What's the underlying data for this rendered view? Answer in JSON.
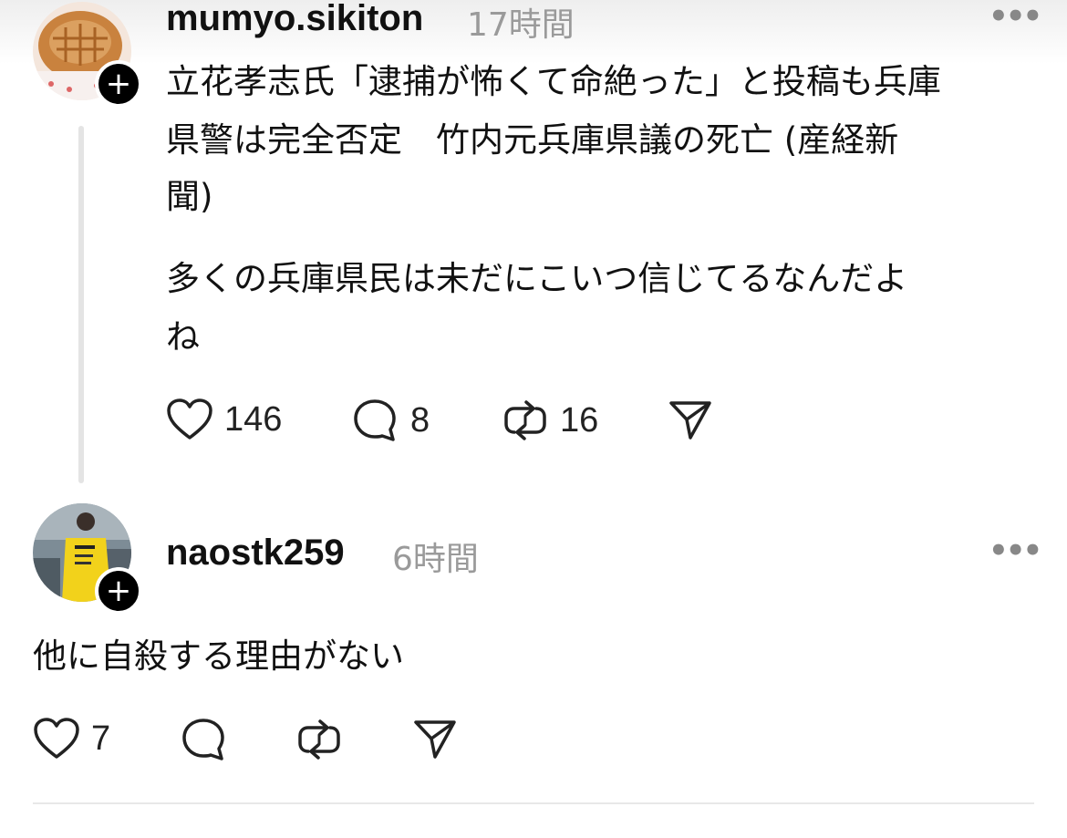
{
  "post1": {
    "username": "mumyo.sikiton",
    "time": "17時間",
    "more": "•••",
    "follow_symbol": "+",
    "line1": "立花孝志氏「逮捕が怖くて命絶った」と投稿も兵庫",
    "line2": "県警は完全否定　竹内元兵庫県議の死亡 (産経新",
    "line3": "聞)",
    "line4": "多くの兵庫県民は未だにこいつ信じてるなんだよ",
    "line5": "ね",
    "likes": "146",
    "replies": "8",
    "reposts": "16"
  },
  "post2": {
    "username": "naostk259",
    "time": "6時間",
    "more": "•••",
    "follow_symbol": "+",
    "text": "他に自殺する理由がない",
    "likes": "7",
    "replies": "",
    "reposts": ""
  },
  "icons": {
    "like": "heart-icon",
    "reply": "comment-icon",
    "repost": "repost-icon",
    "share": "send-icon",
    "follow": "plus-icon",
    "more": "more-icon"
  }
}
